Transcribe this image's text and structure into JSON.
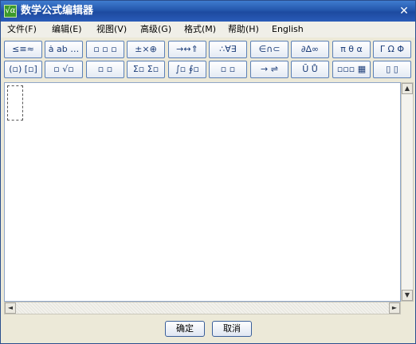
{
  "window": {
    "title": "数学公式编辑器",
    "icon": "app-icon",
    "icon_glyph": "√α",
    "close_glyph": "✕"
  },
  "menu": [
    {
      "label": "文件(F)"
    },
    {
      "label": "编辑(E)"
    },
    {
      "label": "视图(V)"
    },
    {
      "label": "高级(G)"
    },
    {
      "label": "格式(M)"
    },
    {
      "label": "帮助(H)"
    },
    {
      "label": "English"
    }
  ],
  "toolbar_row1": [
    {
      "label": "≤≡≈",
      "icon": "relations-icon"
    },
    {
      "label": "ȧ ab …",
      "icon": "spaces-dots-icon"
    },
    {
      "label": "▫ ▫ ▫",
      "icon": "embellishments-icon"
    },
    {
      "label": "±×⊕",
      "icon": "operators-icon"
    },
    {
      "label": "→↔⇑",
      "icon": "arrows-icon"
    },
    {
      "label": "∴∀∃",
      "icon": "logic-icon"
    },
    {
      "label": "∈∩⊂",
      "icon": "set-theory-icon"
    },
    {
      "label": "∂∆∞",
      "icon": "misc-symbols-icon"
    },
    {
      "label": "π θ α",
      "icon": "greek-lowercase-icon"
    },
    {
      "label": "Γ Ω Φ",
      "icon": "greek-uppercase-icon"
    }
  ],
  "toolbar_row2": [
    {
      "label": "(▫) [▫]",
      "icon": "fences-icon"
    },
    {
      "label": "▫ √▫",
      "icon": "fractions-radicals-icon"
    },
    {
      "label": "▫ ▫",
      "icon": "subscript-superscript-icon"
    },
    {
      "label": "Σ▫ Σ▫",
      "icon": "summation-icon"
    },
    {
      "label": "∫▫ ∮▫",
      "icon": "integrals-icon"
    },
    {
      "label": "▫ ▫",
      "icon": "underbar-overbar-icon"
    },
    {
      "label": "→ ⇌",
      "icon": "labeled-arrows-icon"
    },
    {
      "label": "Ū Ů",
      "icon": "products-icon"
    },
    {
      "label": "▫▫▫ ▦",
      "icon": "matrices-icon"
    },
    {
      "label": "▯ ▯",
      "icon": "templates-icon"
    }
  ],
  "buttons": {
    "ok": "确定",
    "cancel": "取消"
  },
  "scroll": {
    "up": "▲",
    "down": "▼",
    "left": "◄",
    "right": "►"
  }
}
